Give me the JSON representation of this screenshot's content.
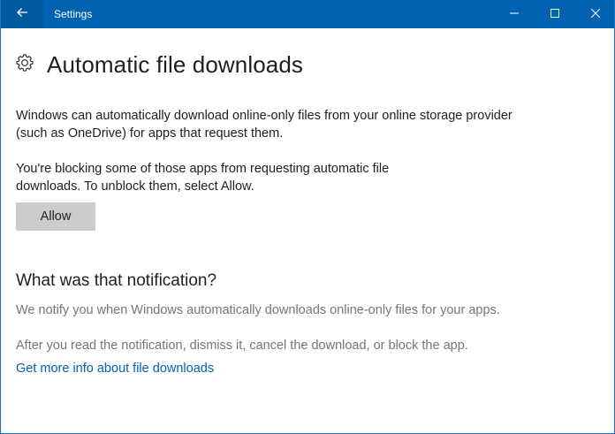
{
  "window": {
    "title": "Settings"
  },
  "icons": {
    "back": "back-arrow-icon",
    "minimize": "minimize-icon",
    "maximize": "maximize-icon",
    "close": "close-icon",
    "header": "gear-icon"
  },
  "colors": {
    "titlebar": "#0063b1",
    "back_button": "#005a9e",
    "link": "#0063b1",
    "button_bg": "#cccccc",
    "muted_text": "#767676"
  },
  "page": {
    "title": "Automatic file downloads",
    "intro": "Windows can automatically download online-only files from your online storage provider (such as OneDrive) for apps that request them.",
    "blocking_text": "You're blocking some of those apps from requesting automatic file downloads. To unblock them, select Allow.",
    "allow_button": "Allow"
  },
  "notification_section": {
    "title": "What was that notification?",
    "text1": "We notify you when Windows automatically downloads online-only files for your apps.",
    "text2": "After you read the notification, dismiss it, cancel the download, or block the app.",
    "link": "Get more info about file downloads"
  }
}
